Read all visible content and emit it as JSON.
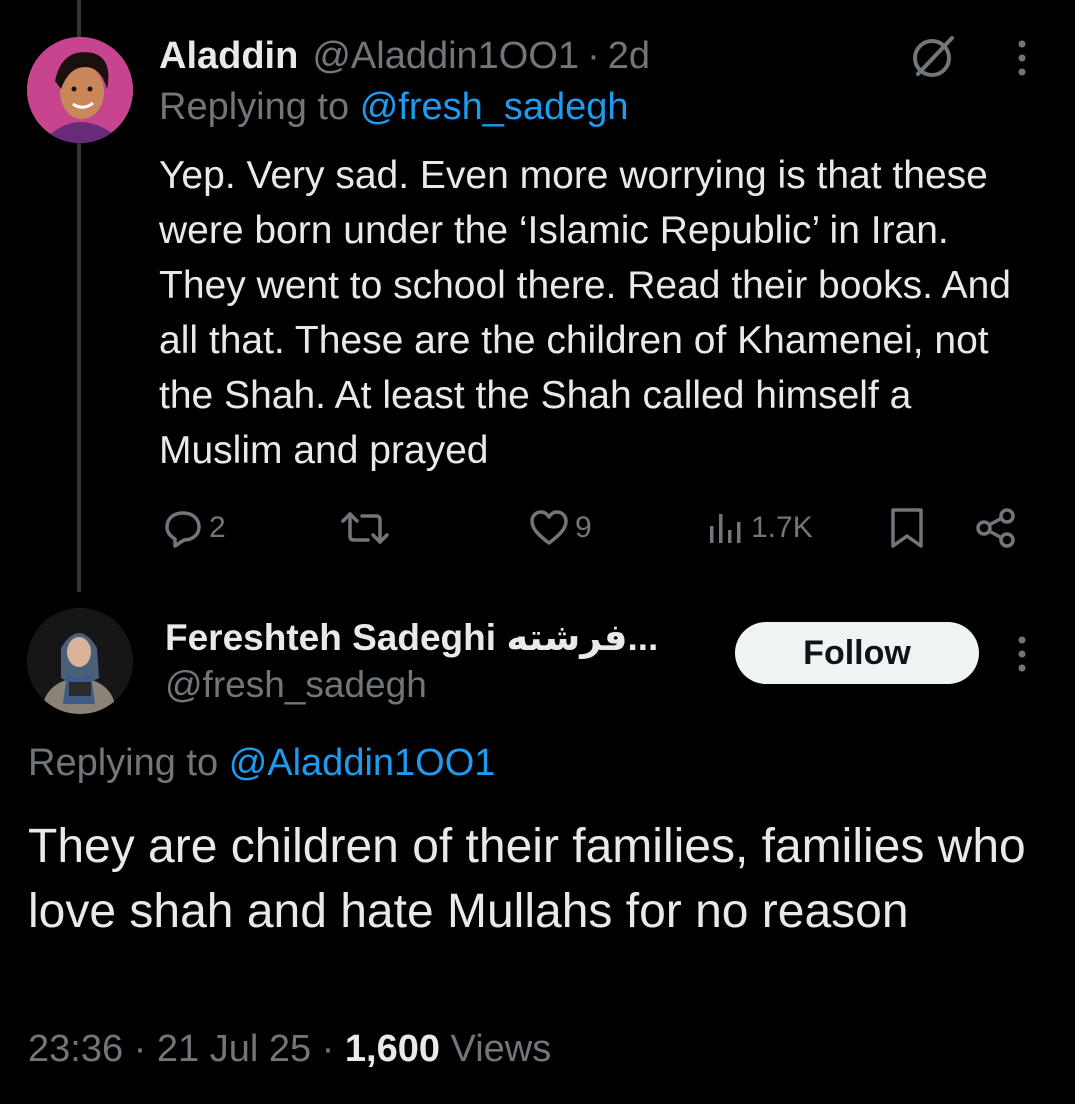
{
  "tweet1": {
    "name": "Aladdin",
    "handle": "@Aladdin1OO1",
    "sep": "·",
    "time": "2d",
    "replying_prefix": "Replying to",
    "replying_handle": "@fresh_sadegh",
    "body": "Yep. Very sad. Even more worrying is that these were born under the ‘Islamic Republic’ in Iran. They went to school there. Read their books. And all that. These are the children of Khamenei, not the Shah. At least the Shah called himself a Muslim and prayed",
    "replies": "2",
    "likes": "9",
    "views": "1.7K"
  },
  "tweet2": {
    "name": "Fereshteh Sadeghi فرشته...",
    "handle": "@fresh_sadegh",
    "follow_label": "Follow",
    "replying_prefix": "Replying to",
    "replying_handle": "@Aladdin1OO1",
    "body": "They are children of their families, families who love shah and hate Mullahs for no reason",
    "time": "23:36",
    "sep1": "·",
    "date": "21 Jul 25",
    "sep2": "·",
    "view_count": "1,600",
    "views_label": "Views"
  },
  "colors": {
    "background": "#000000",
    "text": "#e7e9ea",
    "muted": "#71767b",
    "link": "#1d9bf0",
    "thread_line": "#333639"
  },
  "icons": [
    "grok-icon",
    "more-icon",
    "reply-icon",
    "retweet-icon",
    "like-icon",
    "views-icon",
    "bookmark-icon",
    "share-icon"
  ]
}
